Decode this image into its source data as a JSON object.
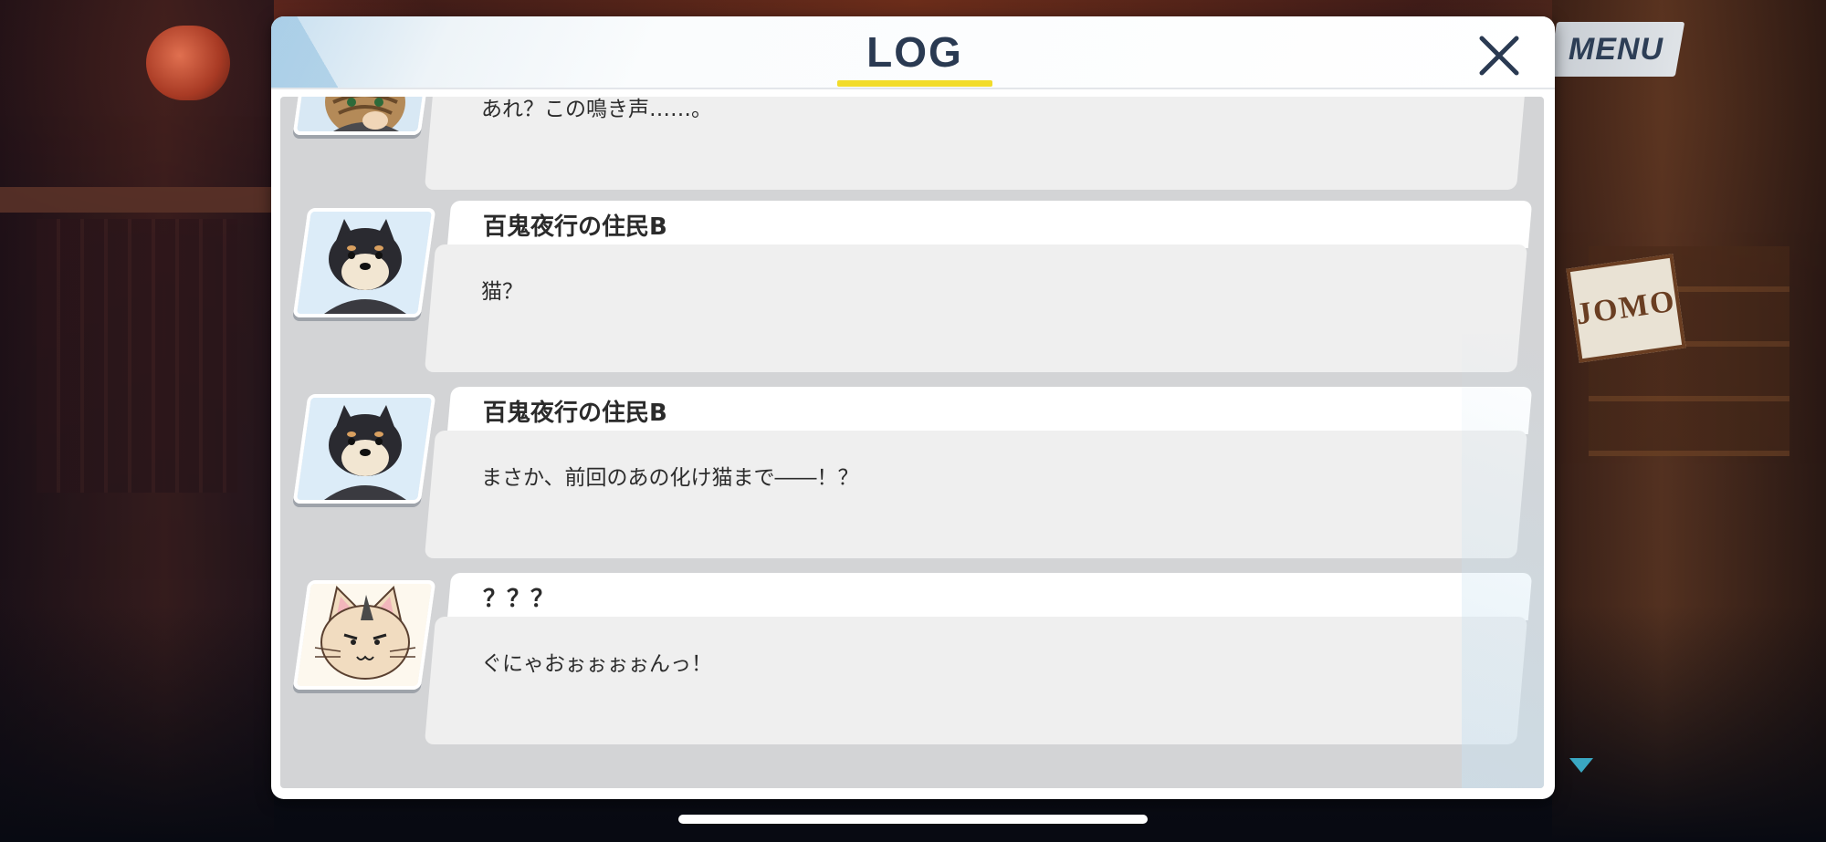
{
  "menu": {
    "label": "MENU"
  },
  "background": {
    "shop_sign": "JOMO"
  },
  "log": {
    "title": "LOG",
    "close_icon": "close-x-icon",
    "entries": [
      {
        "speaker": "",
        "avatar": "tabby-cat-avatar",
        "text": "あれ？この鳴き声……。"
      },
      {
        "speaker": "百鬼夜行の住民B",
        "avatar": "shiba-dog-avatar",
        "text": "猫？"
      },
      {
        "speaker": "百鬼夜行の住民B",
        "avatar": "shiba-dog-avatar",
        "text": "まさか、前回のあの化け猫まで――！？"
      },
      {
        "speaker": "？？？",
        "avatar": "drawn-cat-avatar",
        "text": "ぐにゃおぉぉぉぉんっ！"
      }
    ]
  },
  "colors": {
    "title_text": "#2a3a52",
    "title_underline": "#f2dc2a",
    "scroll_arrow": "#3aa7c2"
  }
}
